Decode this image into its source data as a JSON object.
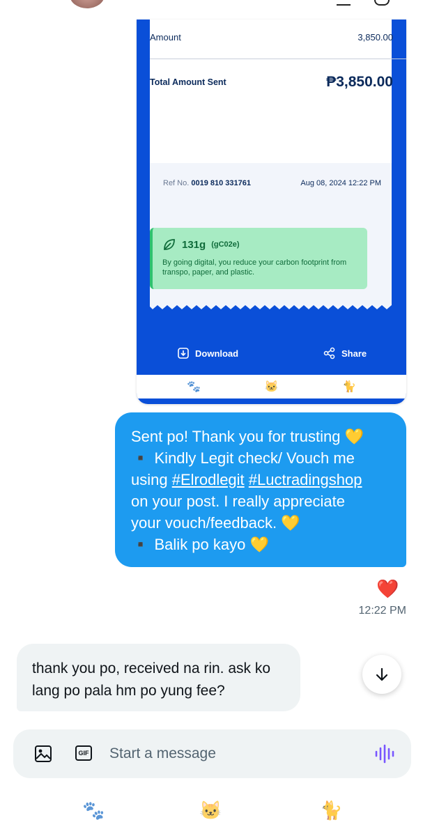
{
  "receipt": {
    "amount_label": "Amount",
    "amount_value": "3,850.00",
    "total_label": "Total Amount Sent",
    "total_value": "₱3,850.00",
    "ref_label": "Ref No.",
    "ref_number": "0019 810 331761",
    "datetime": "Aug 08, 2024 12:22 PM",
    "eco_amount": "131g",
    "eco_unit": "(gC02e)",
    "eco_text": "By going digital, you reduce your carbon footprint from transpo, paper, and plastic.",
    "download_label": "Download",
    "share_label": "Share"
  },
  "messages": {
    "sent": {
      "line1": "Sent po! Thank you for trusting 💛",
      "line2": "▪️ Kindly Legit check/ Vouch me",
      "line3_prefix": "using ",
      "tag1": "#Elrodlegit",
      "tag2": "#Luctradingshop",
      "line4": "on your post. I really appreciate",
      "line5": "your vouch/feedback. 💛",
      "line6": "▪️  Balik po kayo 💛",
      "reaction": "❤️",
      "time": "12:22 PM"
    },
    "received": {
      "text": "thank you po, received na rin. ask ko lang po pala hm po yung fee?"
    }
  },
  "composer": {
    "placeholder": "Start a message",
    "gif_label": "GIF"
  },
  "icons": {
    "receipt_tabs": [
      "🐾",
      "🐱",
      "🐈"
    ],
    "bottom_nav": [
      "🐾",
      "🐱",
      "🐈"
    ]
  },
  "colors": {
    "gcash_blue": "#0a4fd8",
    "bubble_blue": "#1d9bf0",
    "eco_green": "#a7ebc3"
  }
}
